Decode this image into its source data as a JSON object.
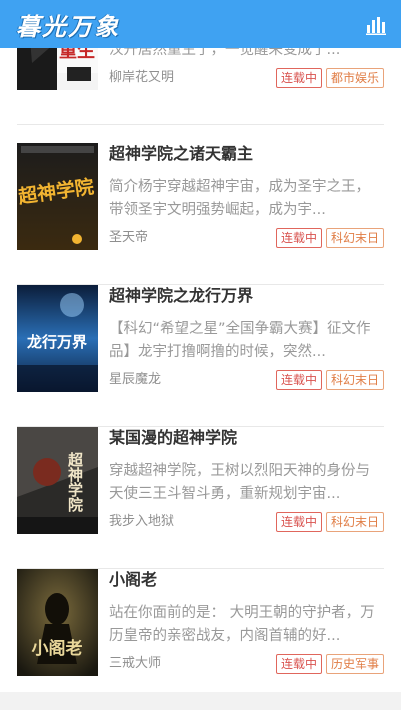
{
  "header": {
    "logo_text": "暮光万象",
    "rank_icon": "ranking-bars-icon",
    "bg_color": "#3fa2f2"
  },
  "books": [
    {
      "title": "",
      "description": "万万没想到，在去请英一语日本导弹的陈汉升居然重生了，一觉醒来变成了...",
      "author": "柳岸花又明",
      "status": "连载中",
      "genre": "都市娱乐",
      "cover_text": "重生"
    },
    {
      "title": "超神学院之诸天霸主",
      "description": "简介杨宇穿越超神宇宙，成为圣宇之王，带领圣宇文明强势崛起，成为宇...",
      "author": "圣天帝",
      "status": "连载中",
      "genre": "科幻末日",
      "cover_text": "超神学院"
    },
    {
      "title": "超神学院之龙行万界",
      "description": "【科幻“希望之星”全国争霸大赛】征文作品】龙宇打撸啊撸的时候，突然...",
      "author": "星辰魔龙",
      "status": "连载中",
      "genre": "科幻末日",
      "cover_text": "龙行万界"
    },
    {
      "title": "某国漫的超神学院",
      "description": "穿越超神学院，王树以烈阳天神的身份与天使三王斗智斗勇，重新规划宇宙...",
      "author": "我步入地狱",
      "status": "连载中",
      "genre": "科幻末日",
      "cover_text": "超神学院"
    },
    {
      "title": "小阁老",
      "description": "站在你面前的是： 大明王朝的守护者，万历皇帝的亲密战友，内阁首辅的好...",
      "author": "三戒大师",
      "status": "连载中",
      "genre": "历史军事",
      "cover_text": "小阁老"
    }
  ]
}
